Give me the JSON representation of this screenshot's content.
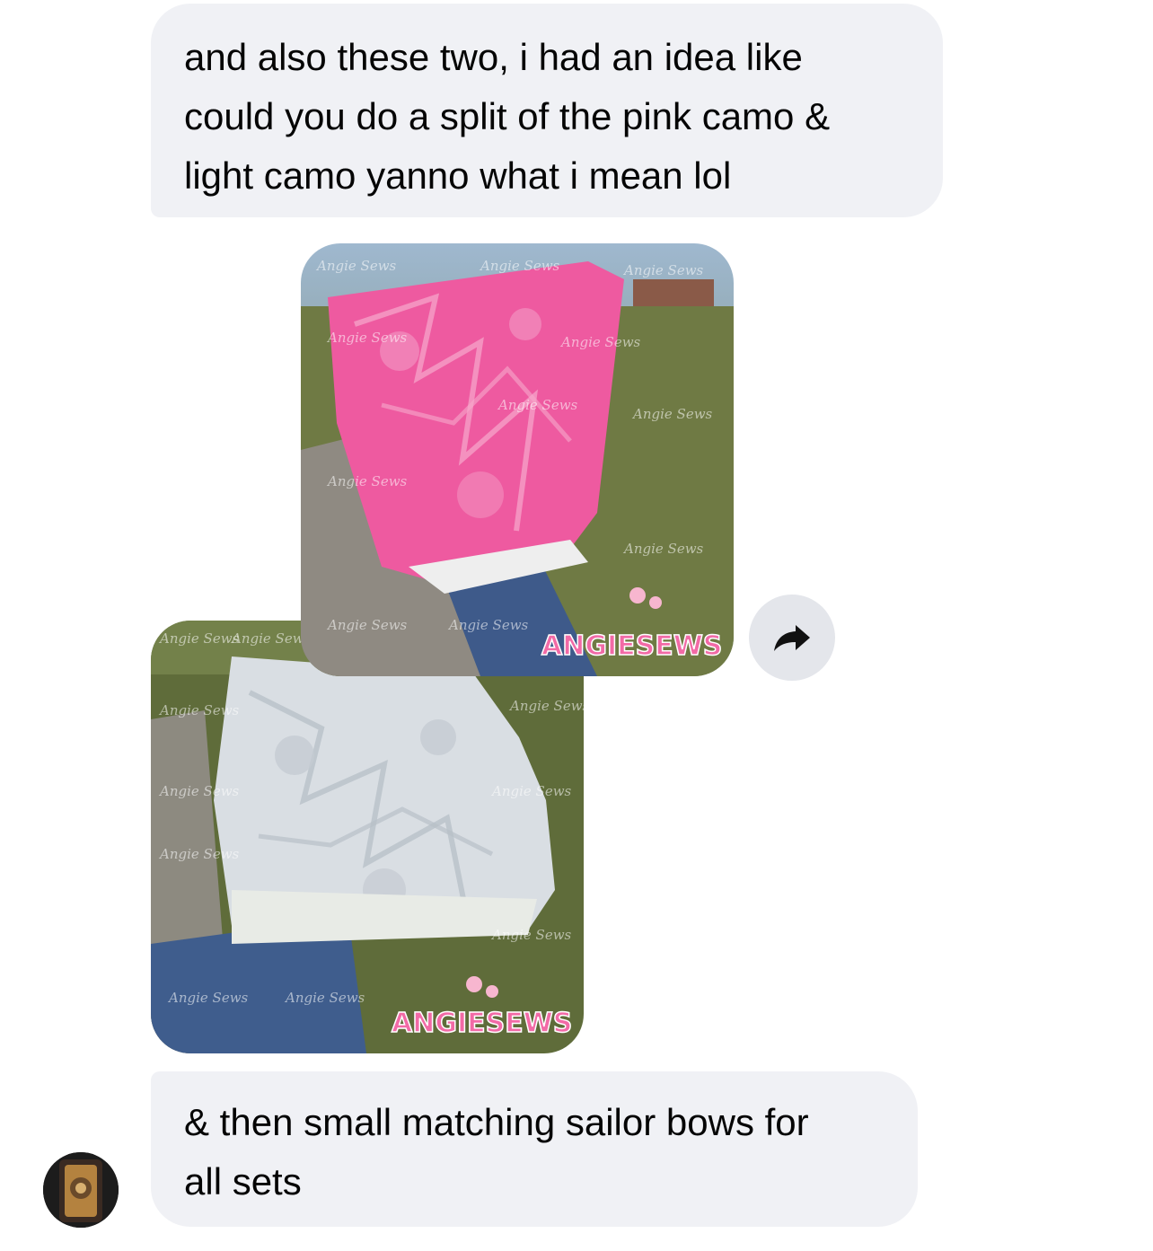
{
  "messages": [
    {
      "lines": [
        "and also these two, i had an idea like",
        "could you do a split of the pink camo &",
        "light camo yanno what i mean lol"
      ]
    },
    {
      "lines": [
        "& then small matching sailor bows for",
        "all sets"
      ]
    }
  ],
  "photos": {
    "watermark": "Angie Sews",
    "brand": "ANGIESEWS",
    "pink_fabric_color": "#ee5aa0",
    "grey_fabric_color": "#d9dee3"
  },
  "icons": {
    "forward": "forward-arrow-icon",
    "avatar": "contact-avatar"
  },
  "colors": {
    "bubble": "#f0f1f5",
    "text": "#050505",
    "forward_bg": "#e4e6eb"
  }
}
